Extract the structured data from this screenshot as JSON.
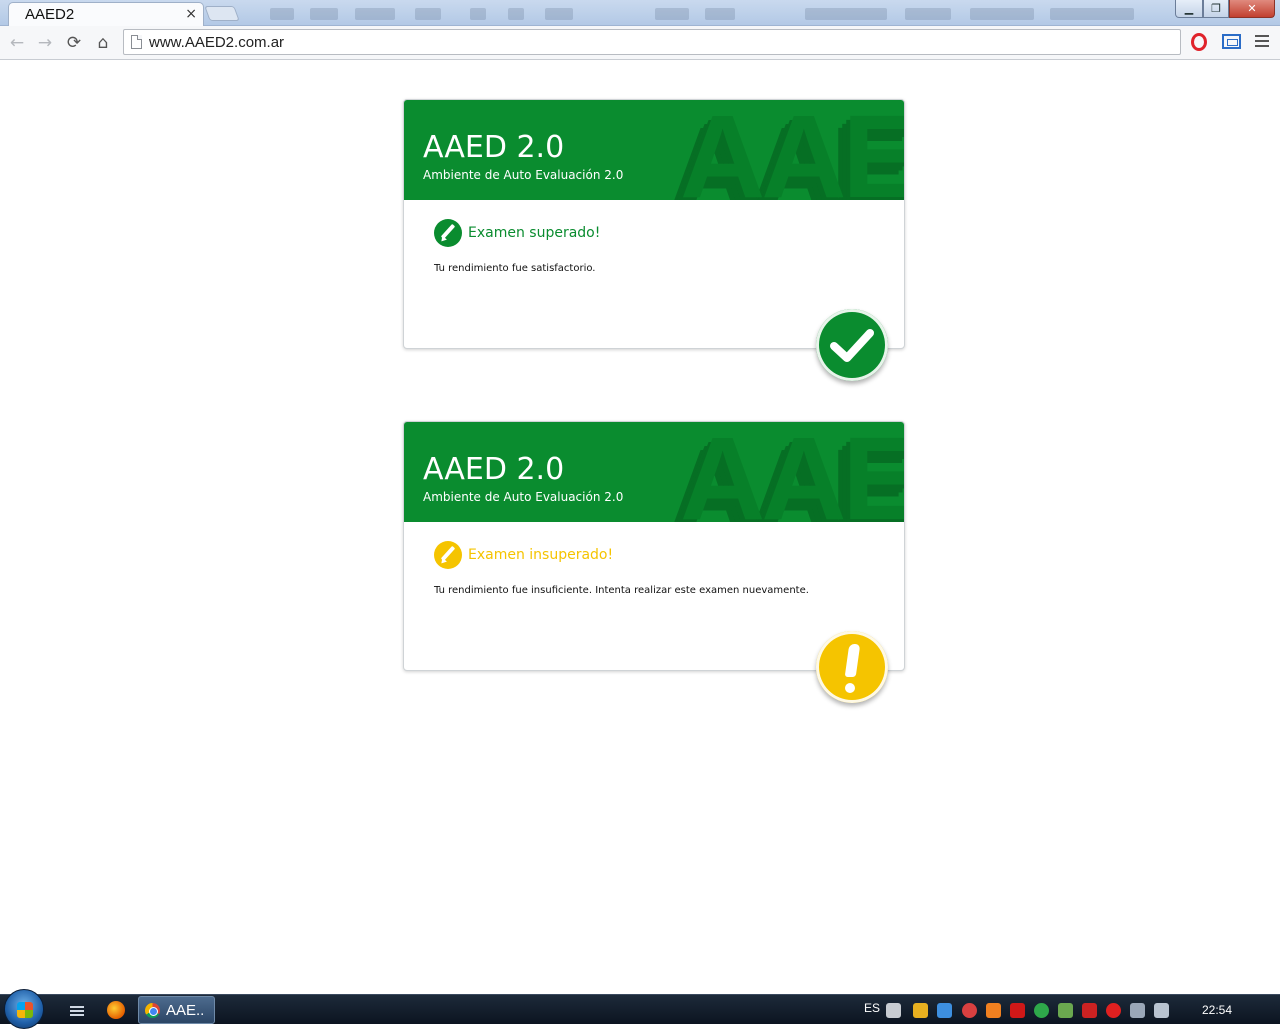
{
  "browser": {
    "tab_title": "AAED2",
    "tab_close": "×",
    "url": "www.AAED2.com.ar",
    "window_buttons": {
      "minimize": "▁",
      "maximize": "❐",
      "close": "✕"
    },
    "nav": {
      "back": "←",
      "forward": "→",
      "reload": "⟳",
      "home": "⌂"
    }
  },
  "cards": [
    {
      "title": "AAED 2.0",
      "subtitle": "Ambiente de Auto Evaluación 2.0",
      "watermark": "AAED",
      "status": "Examen superado!",
      "message": "Tu rendimiento fue satisfactorio.",
      "status_color": "#0a8c2f",
      "badge_icon": "checkmark-icon"
    },
    {
      "title": "AAED 2.0",
      "subtitle": "Ambiente de Auto Evaluación 2.0",
      "watermark": "AAED",
      "status": "Examen insuperado!",
      "message": "Tu rendimiento fue insuficiente. Intenta realizar este examen nuevamente.",
      "status_color": "#f5c400",
      "badge_icon": "exclamation-icon"
    }
  ],
  "colors": {
    "header_green": "#0a8c2f",
    "success_green": "#0a8c2f",
    "warning_yellow": "#f5c400"
  },
  "taskbar": {
    "task_label": "AAE..",
    "language": "ES",
    "clock": "22:54"
  }
}
